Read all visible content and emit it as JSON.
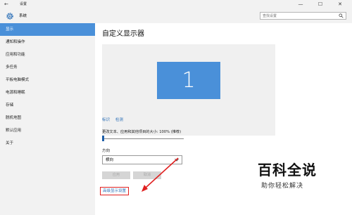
{
  "window": {
    "title": "设置"
  },
  "header": {
    "section": "系统",
    "search_placeholder": "查找设置"
  },
  "sidebar": {
    "items": [
      {
        "label": "显示",
        "active": true
      },
      {
        "label": "通知和操作"
      },
      {
        "label": "应用和功能"
      },
      {
        "label": "多任务"
      },
      {
        "label": "平板电脑模式"
      },
      {
        "label": "电源和睡眠"
      },
      {
        "label": "存储"
      },
      {
        "label": "脱机地图"
      },
      {
        "label": "默认应用"
      },
      {
        "label": "关于"
      }
    ]
  },
  "main": {
    "title": "自定义显示器",
    "monitor_number": "1",
    "identify_link": "标识",
    "detect_link": "检测",
    "scale_label": "更改文本、应用和其他项目的大小: 100% (推荐)",
    "scale_value": 100,
    "orientation_label": "方向",
    "orientation_value": "横向",
    "apply_button": "应用",
    "cancel_button": "取消",
    "advanced_link": "高级显示设置"
  },
  "watermark": {
    "title": "百科全说",
    "subtitle": "助你轻松解决"
  },
  "colors": {
    "accent": "#4a90d9",
    "link": "#2b6fb7",
    "highlight": "#e02020"
  },
  "icons": {
    "back": "back-arrow-icon",
    "settings": "gear-icon",
    "search": "search-icon"
  }
}
